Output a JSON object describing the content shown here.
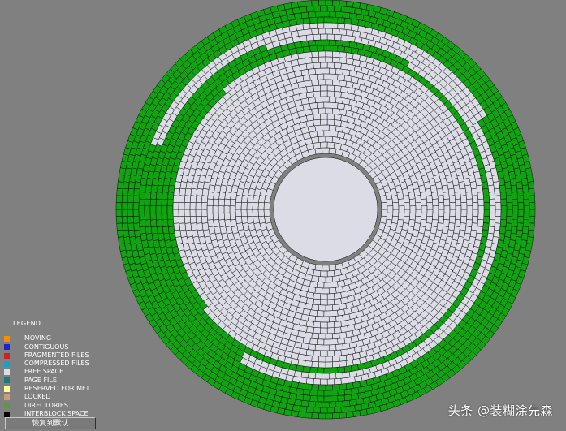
{
  "legend": {
    "title": "LEGEND",
    "items": [
      {
        "label": "MOVING",
        "color": "#ff8c00"
      },
      {
        "label": "CONTIGUOUS",
        "color": "#2222cc"
      },
      {
        "label": "FRAGMENTED FILES",
        "color": "#cc2222"
      },
      {
        "label": "COMPRESSED FILES",
        "color": "#1aa0c8"
      },
      {
        "label": "FREE SPACE",
        "color": "#dcdce6"
      },
      {
        "label": "PAGE FILE",
        "color": "#1e7a78"
      },
      {
        "label": "RESERVED FOR MFT",
        "color": "#ffff99"
      },
      {
        "label": "LOCKED",
        "color": "#c8a078"
      },
      {
        "label": "DIRECTORIES",
        "color": "#5a9a3a"
      },
      {
        "label": "INTERBLOCK SPACE",
        "color": "#000000"
      }
    ]
  },
  "reset_button": {
    "label": "恢复到默认"
  },
  "watermark": {
    "text": "头条 @装糊涂先森"
  },
  "colors": {
    "background": "#808080",
    "used_block": "#11a411",
    "free_block": "#dcdce6",
    "hub": "#dcdce6",
    "block_border": "#000000"
  }
}
